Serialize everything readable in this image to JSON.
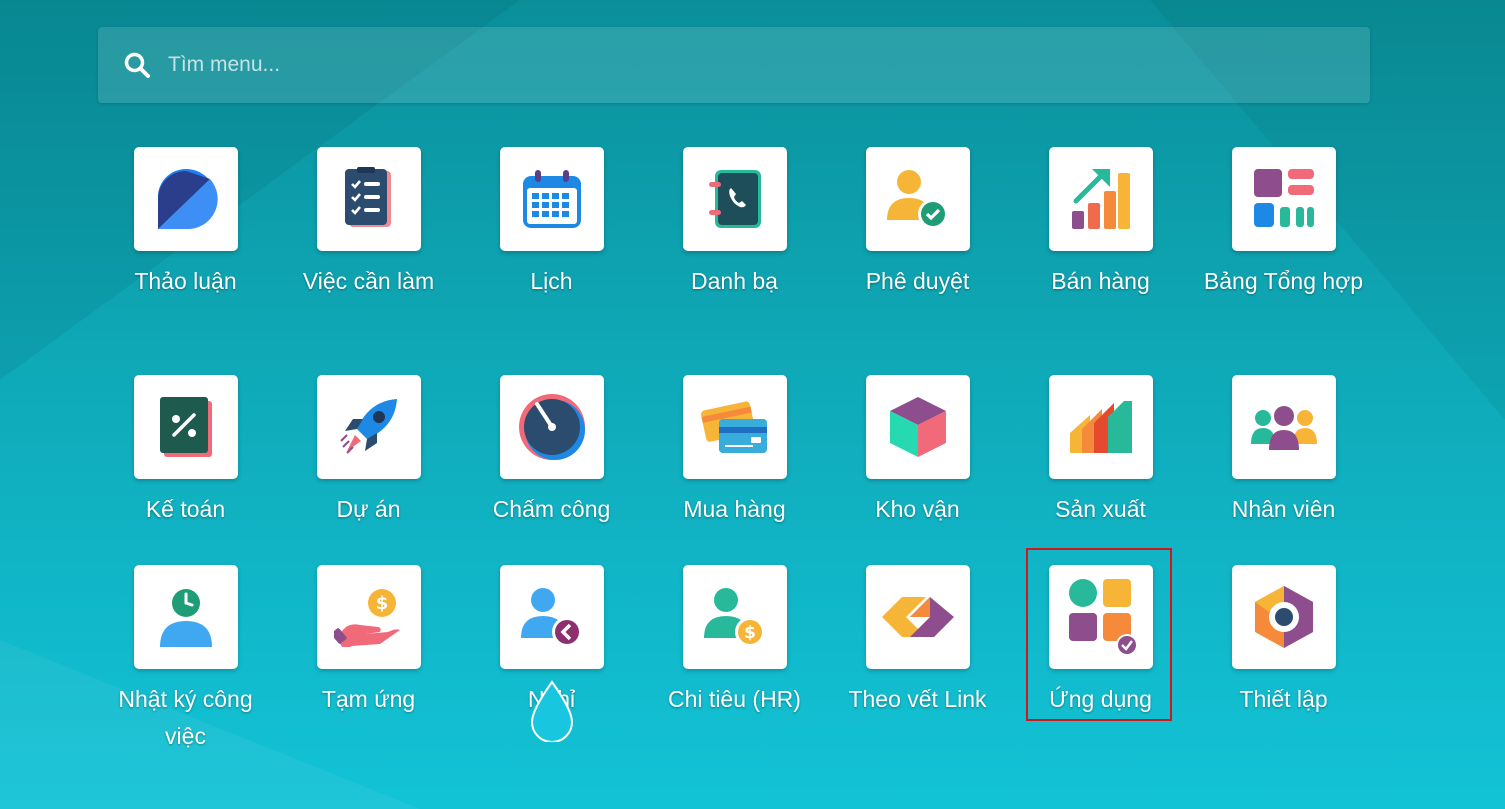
{
  "search": {
    "placeholder": "Tìm menu..."
  },
  "apps": [
    {
      "label": "Thảo luận",
      "icon": "discuss-icon"
    },
    {
      "label": "Việc cần làm",
      "icon": "todo-checklist-icon"
    },
    {
      "label": "Lịch",
      "icon": "calendar-icon"
    },
    {
      "label": "Danh bạ",
      "icon": "contacts-phonebook-icon"
    },
    {
      "label": "Phê duyệt",
      "icon": "approval-user-check-icon"
    },
    {
      "label": "Bán hàng",
      "icon": "sales-growth-chart-icon"
    },
    {
      "label": "Bảng Tổng hợp",
      "icon": "dashboard-tiles-icon"
    },
    {
      "label": "Kế toán",
      "icon": "accounting-percent-icon"
    },
    {
      "label": "Dự án",
      "icon": "project-rocket-icon"
    },
    {
      "label": "Chấm công",
      "icon": "timesheet-gauge-icon"
    },
    {
      "label": "Mua hàng",
      "icon": "purchase-cards-icon"
    },
    {
      "label": "Kho vận",
      "icon": "inventory-box-icon"
    },
    {
      "label": "Sản xuất",
      "icon": "manufacturing-icon"
    },
    {
      "label": "Nhân viên",
      "icon": "employees-group-icon"
    },
    {
      "label": "Nhật ký công việc",
      "icon": "work-log-clock-user-icon"
    },
    {
      "label": "Tạm ứng",
      "icon": "advance-money-hand-icon"
    },
    {
      "label": "Nghỉ",
      "icon": "time-off-user-icon"
    },
    {
      "label": "Chi tiêu (HR)",
      "icon": "expense-user-dollar-icon"
    },
    {
      "label": "Theo vết Link",
      "icon": "link-tracker-icon"
    },
    {
      "label": "Ứng dụng",
      "icon": "apps-grid-icon"
    },
    {
      "label": "Thiết lập",
      "icon": "settings-hexagon-icon"
    }
  ],
  "highlighted_app": "Ứng dụng",
  "colors": {
    "background_top": "#0a8f99",
    "background_bottom": "#12c3d6",
    "highlight_border": "#d0171c",
    "tile": "#ffffff"
  }
}
